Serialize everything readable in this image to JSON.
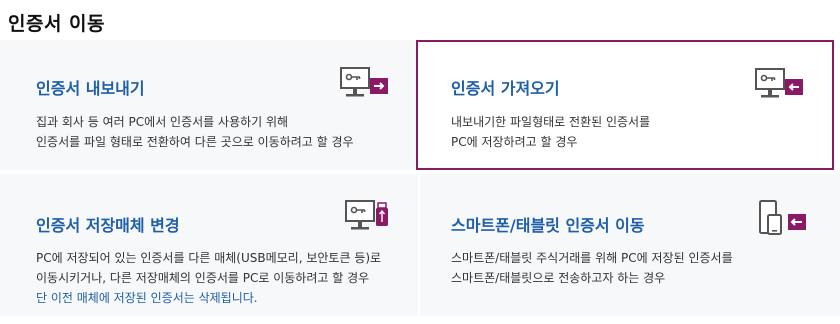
{
  "page": {
    "title": "인증서 이동"
  },
  "cards": [
    {
      "title": "인증서 내보내기",
      "desc": [
        "집과 회사 등 여러 PC에서 인증서를 사용하기 위해",
        "인증서를 파일 형태로 전환하여 다른 곳으로 이동하려고 할 경우"
      ],
      "icon": "monitor-export-icon"
    },
    {
      "title": "인증서 가져오기",
      "desc": [
        "내보내기한 파일형태로 전환된 인증서를",
        "PC에 저장하려고 할 경우"
      ],
      "icon": "monitor-import-icon",
      "selected": true
    },
    {
      "title": "인증서 저장매체 변경",
      "desc": [
        "PC에 저장되어 있는 인증서를 다른 매체(USB메모리, 보안토큰 등)로",
        "이동시키거나, 다른 저장매체의 인증서를 PC로 이동하려고 할 경우"
      ],
      "note": "단 이전 매체에 저장된 인증서는 삭제됩니다.",
      "icon": "monitor-usb-icon"
    },
    {
      "title": "스마트폰/태블릿 인증서 이동",
      "desc": [
        "스마트폰/태블릿 주식거래를 위해 PC에 저장된 인증서를",
        "스마트폰/태블릿으로 전송하고자 하는 경우"
      ],
      "icon": "phone-tablet-transfer-icon"
    }
  ],
  "colors": {
    "accent": "#8a1a66",
    "title": "#1f5fa8",
    "card_bg": "#f7f8fa",
    "icon": "#555555"
  }
}
